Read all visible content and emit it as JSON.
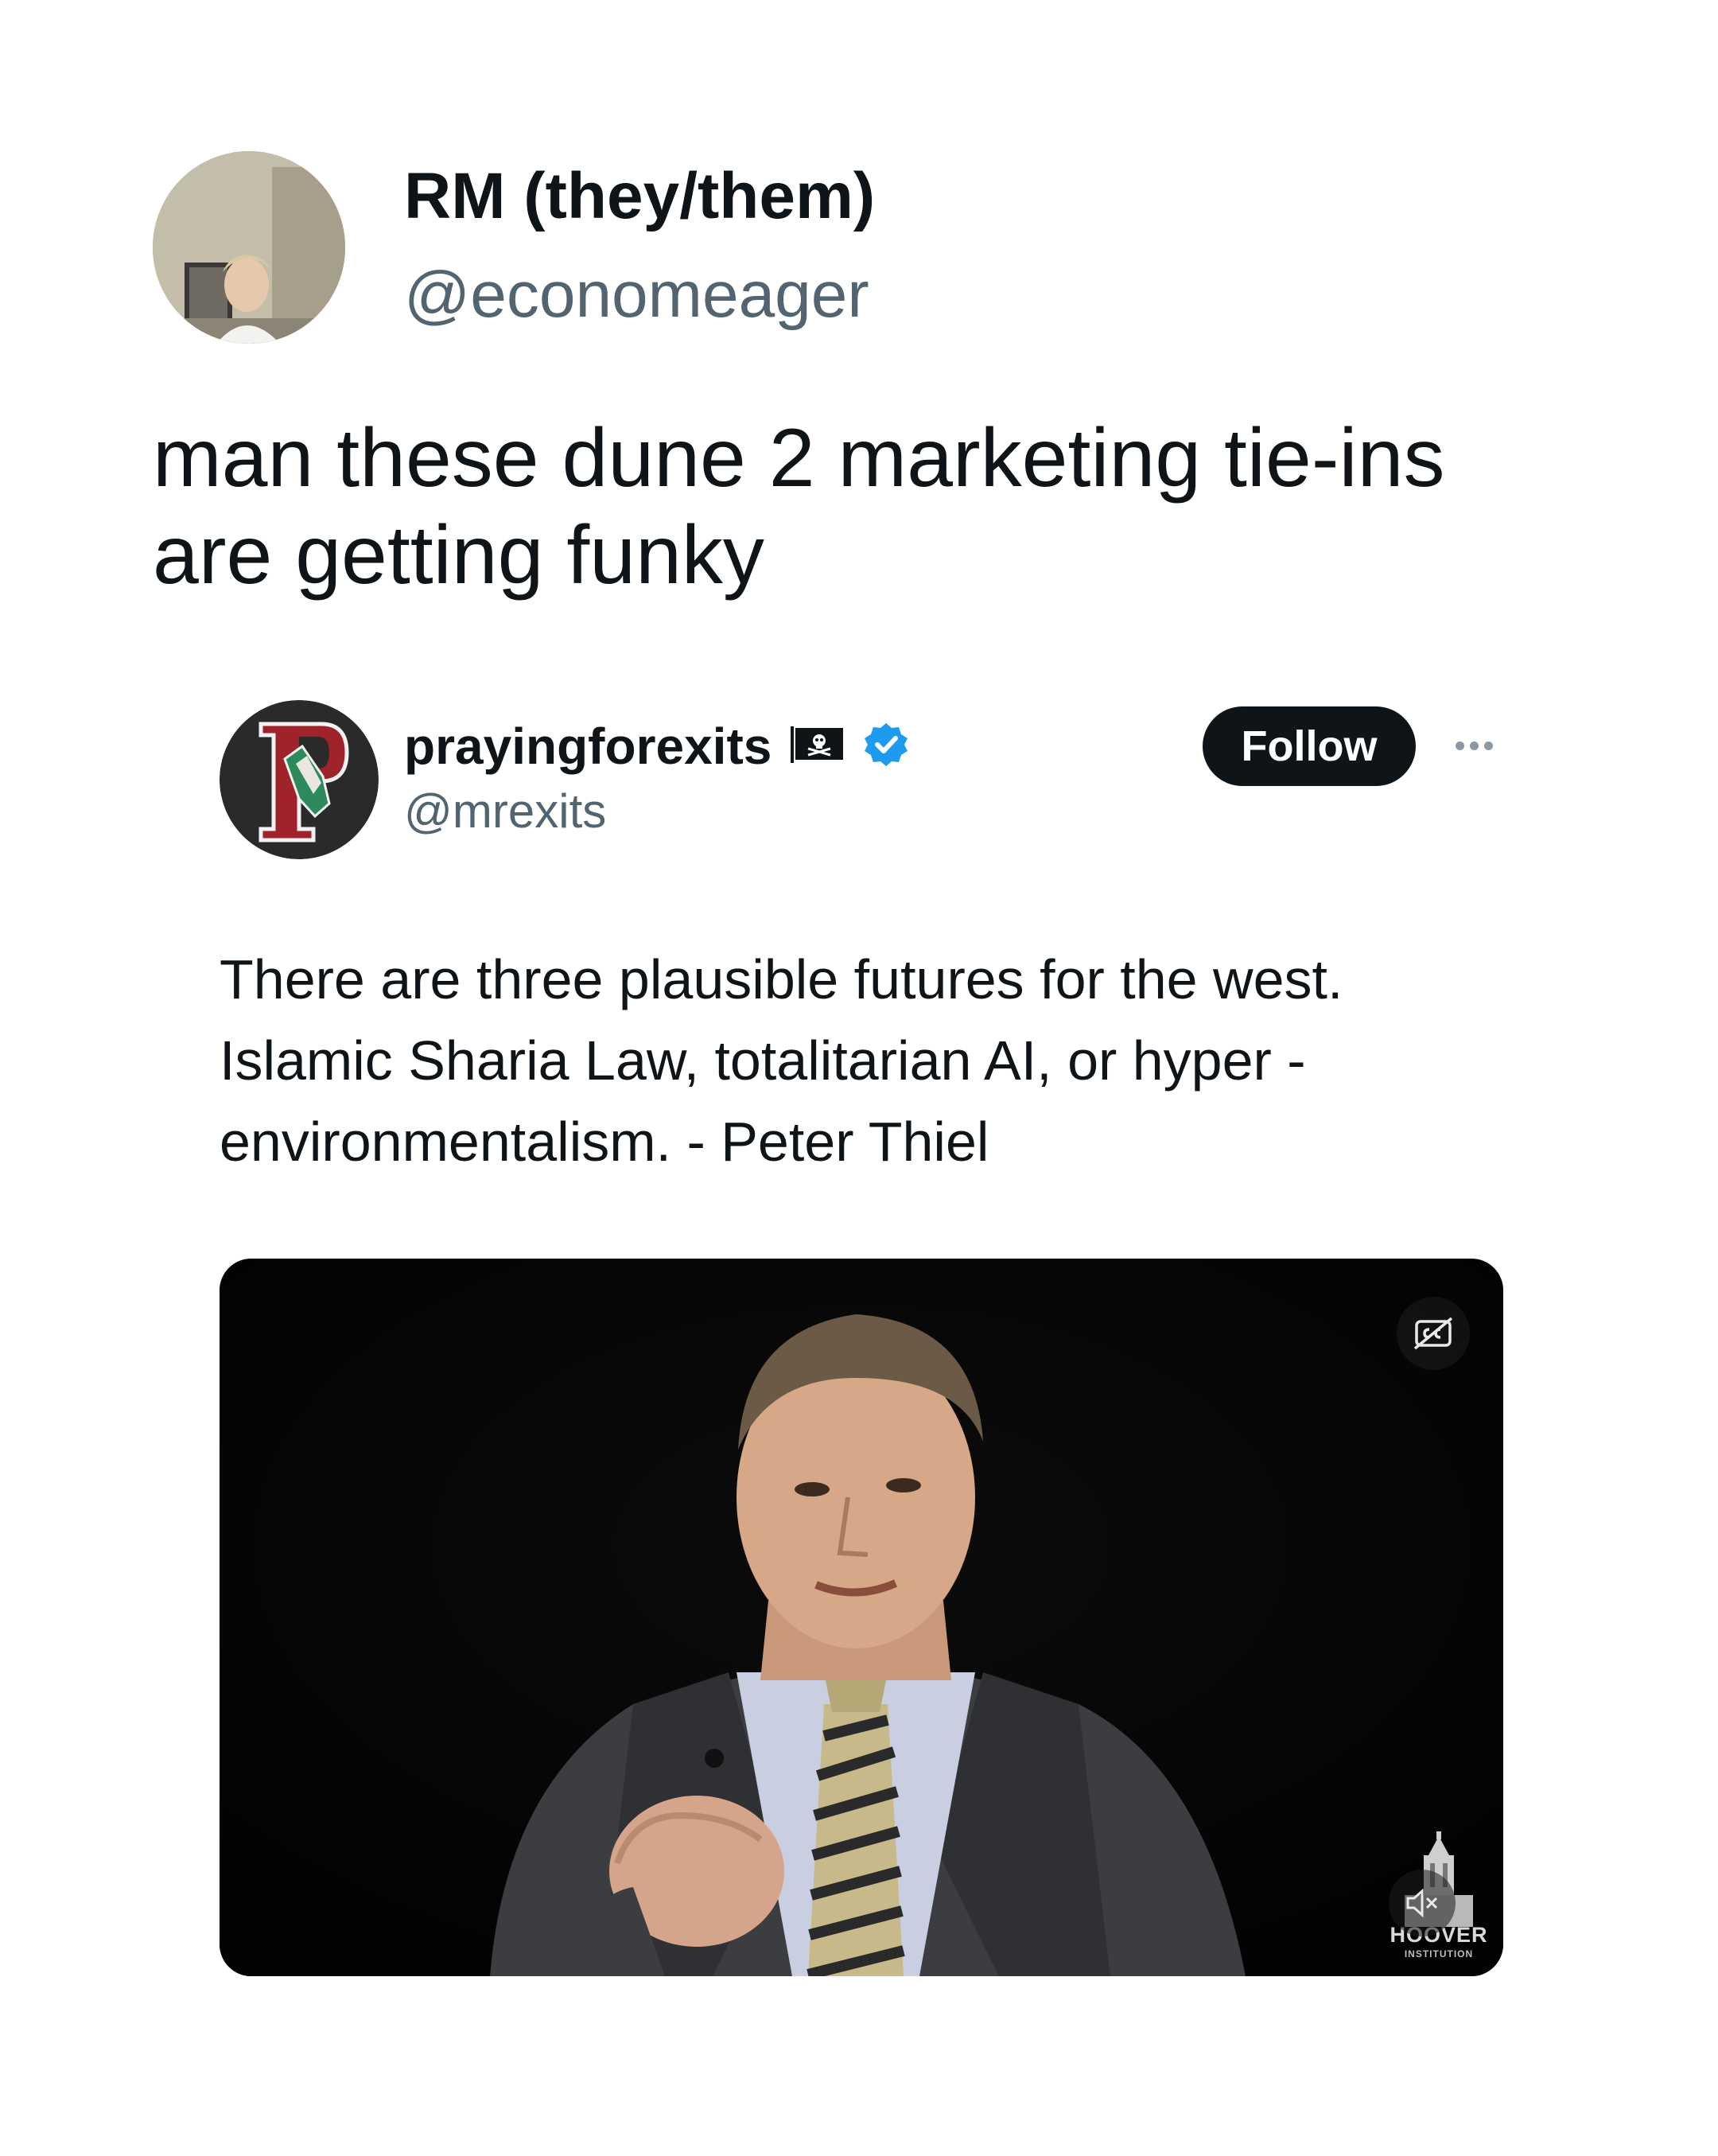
{
  "outer_tweet": {
    "author_name": "RM (they/them)",
    "author_handle": "@economeager",
    "text": "man these dune 2 marketing tie-ins are getting funky"
  },
  "quoted_tweet": {
    "author_name": "prayingforexits",
    "author_handle": "@mrexits",
    "follow_label": "Follow",
    "text": "There are three plausible futures for the west. Islamic Sharia Law, totalitarian AI, or hyper - environmentalism. - Peter Thiel",
    "badges": [
      "pirate-flag-icon",
      "verified-badge-icon"
    ],
    "verified_color": "#1d9bf0"
  },
  "video": {
    "watermark": "HOOVER",
    "watermark_sub": "INSTITUTION",
    "controls": [
      "captions-icon",
      "muted-speaker-icon"
    ]
  },
  "colors": {
    "text_primary": "#0f1419",
    "text_secondary": "#536471",
    "follow_bg": "#0f1419",
    "follow_text": "#ffffff"
  }
}
